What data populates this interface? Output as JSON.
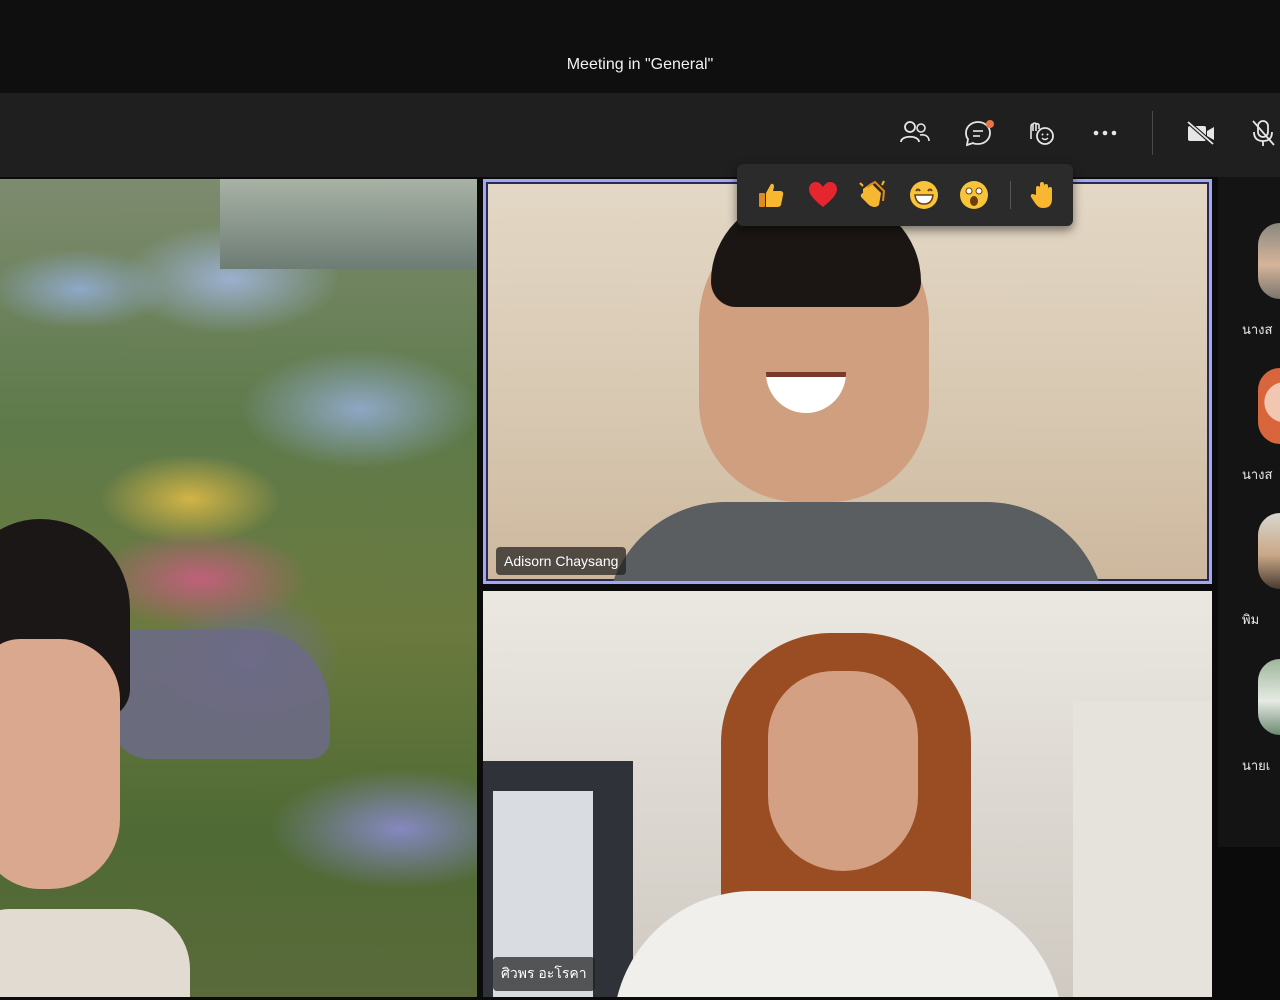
{
  "window": {
    "title": "Meeting in \"General\""
  },
  "toolbar": {
    "buttons": [
      {
        "name": "participants",
        "icon": "people-icon"
      },
      {
        "name": "chat",
        "icon": "chat-icon",
        "has_notification": true
      },
      {
        "name": "reactions",
        "icon": "reaction-icon"
      },
      {
        "name": "more-actions",
        "icon": "more-icon"
      },
      {
        "name": "camera",
        "icon": "camera-off-icon"
      },
      {
        "name": "mic",
        "icon": "mic-off-icon"
      }
    ],
    "accent": "#e97548"
  },
  "reactions": [
    {
      "name": "like",
      "icon": "thumbs-up-icon"
    },
    {
      "name": "heart",
      "icon": "heart-icon"
    },
    {
      "name": "applause",
      "icon": "clap-icon"
    },
    {
      "name": "laugh",
      "icon": "laugh-icon"
    },
    {
      "name": "surprised",
      "icon": "surprised-icon"
    },
    {
      "name": "raise-hand",
      "icon": "raised-hand-icon"
    }
  ],
  "videos": {
    "adisorn": {
      "name": "Adisorn Chaysang",
      "active_speaker_color": "#a3a6f0"
    },
    "siwaporn": {
      "name": "ศิวพร อะโรคา"
    }
  },
  "roster": [
    {
      "label": "นางส"
    },
    {
      "label": "นางส"
    },
    {
      "label": "พิม"
    },
    {
      "label": "นายเ"
    }
  ]
}
